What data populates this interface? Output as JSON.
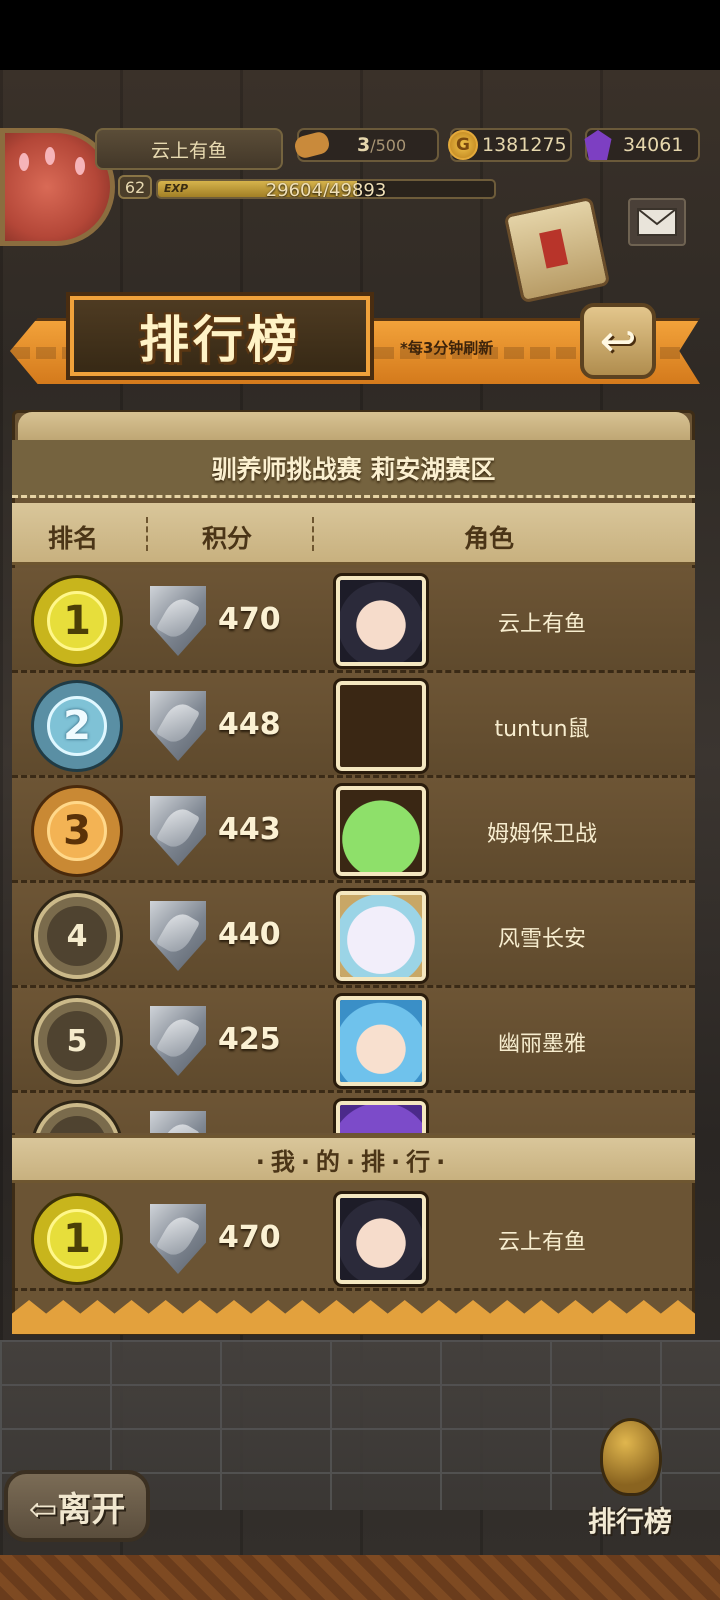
{
  "hud": {
    "player_name": "云上有鱼",
    "stamina": {
      "current": "3",
      "max": "/500"
    },
    "gold": "1381275",
    "gems": "34061",
    "level": "62",
    "exp": {
      "label": "EXP",
      "text": "29604/49893",
      "fraction": 0.593
    }
  },
  "banner": {
    "title": "排行榜",
    "refresh_note": "*每3分钟刷新",
    "back_icon": "↩"
  },
  "board": {
    "subtitle": "驯养师挑战赛 莉安湖赛区",
    "columns": {
      "rank": "排名",
      "score": "积分",
      "role": "角色"
    },
    "rows": [
      {
        "rank": "1",
        "score": "470",
        "name": "云上有鱼",
        "medal": "gold",
        "portrait": "girl-dark-hair"
      },
      {
        "rank": "2",
        "score": "448",
        "name": "tuntun鼠",
        "medal": "silver",
        "portrait": "empty"
      },
      {
        "rank": "3",
        "score": "443",
        "name": "姆姆保卫战",
        "medal": "bronze",
        "portrait": "green-slime"
      },
      {
        "rank": "4",
        "score": "440",
        "name": "风雪长安",
        "medal": "plain",
        "portrait": "white-creature"
      },
      {
        "rank": "5",
        "score": "425",
        "name": "幽丽墨雅",
        "medal": "plain",
        "portrait": "blue-hair-girl"
      },
      {
        "rank": "",
        "score": "",
        "name": "",
        "medal": "plain",
        "portrait": "purple-hair"
      }
    ],
    "my_rank_label": "·我·的·排·行·",
    "my_rank": {
      "rank": "1",
      "score": "470",
      "name": "云上有鱼",
      "medal": "gold",
      "portrait": "girl-dark-hair"
    }
  },
  "buttons": {
    "leave": "⇦离开",
    "leaderboard": "排行榜"
  },
  "colors": {
    "accent_orange": "#e3a13d",
    "board_brown": "#6b5434",
    "header_tan": "#d9c69a"
  }
}
